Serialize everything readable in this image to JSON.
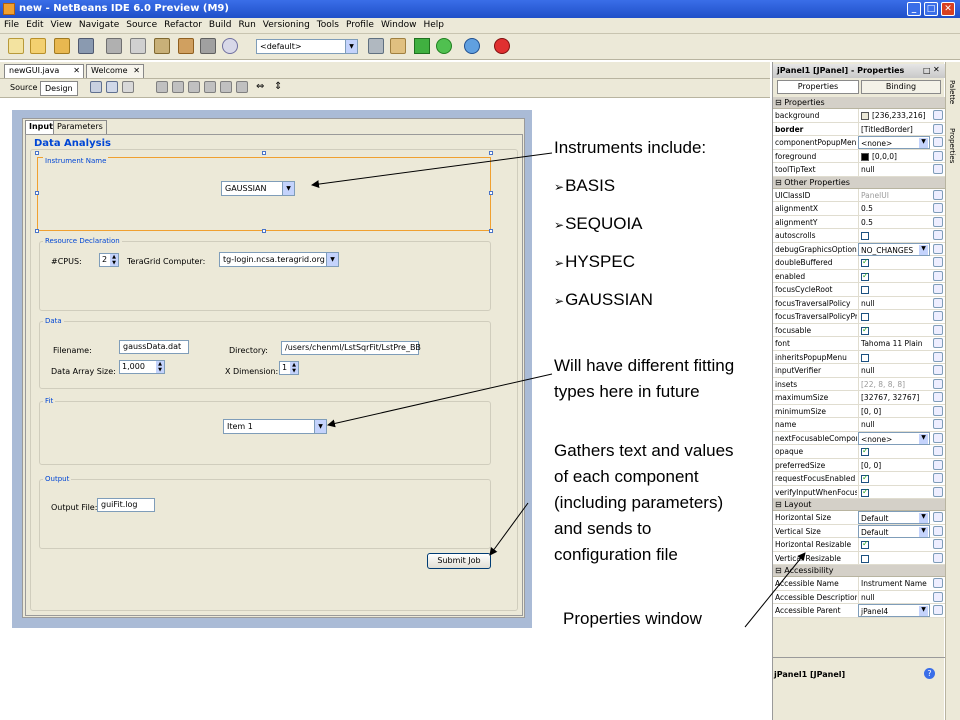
{
  "window": {
    "title": "new - NetBeans IDE 6.0 Preview (M9)"
  },
  "menu": [
    "File",
    "Edit",
    "View",
    "Navigate",
    "Source",
    "Refactor",
    "Build",
    "Run",
    "Versioning",
    "Tools",
    "Profile",
    "Window",
    "Help"
  ],
  "toolbar": {
    "config_value": "<default>"
  },
  "editor_tabs": [
    {
      "label": "newGUI.java"
    },
    {
      "label": "Welcome"
    }
  ],
  "view_buttons": {
    "source": "Source",
    "design": "Design"
  },
  "form": {
    "tabs": [
      "Input",
      "Parameters"
    ],
    "title": "Data Analysis",
    "instrument": {
      "legend": "Instrument Name",
      "value": "GAUSSIAN"
    },
    "resource": {
      "legend": "Resource Declaration",
      "cpus_label": "#CPUS:",
      "cpus_value": "2",
      "computer_label": "TeraGrid Computer:",
      "computer_value": "tg-login.ncsa.teragrid.org"
    },
    "data": {
      "legend": "Data",
      "filename_label": "Filename:",
      "filename_value": "gaussData.dat",
      "directory_label": "Directory:",
      "directory_value": "/users/chenml/LstSqrFit/LstPre_BB",
      "size_label": "Data Array Size:",
      "size_value": "1,000",
      "xdim_label": "X Dimension:",
      "xdim_value": "1"
    },
    "fit": {
      "legend": "Fit",
      "value": "Item 1"
    },
    "output": {
      "legend": "Output",
      "file_label": "Output File:",
      "file_value": "guiFit.log"
    },
    "submit": "Submit Job"
  },
  "properties": {
    "header": "jPanel1 [JPanel] - Properties",
    "tabs": [
      "Properties",
      "Binding"
    ],
    "categories": [
      {
        "name": "Properties",
        "rows": [
          {
            "name": "background",
            "value": "[236,233,216]",
            "swatch": "#ece9d8"
          },
          {
            "name": "border",
            "value": "[TitledBorder]",
            "bold": true
          },
          {
            "name": "componentPopupMenu",
            "value": "<none>",
            "combo": true
          },
          {
            "name": "foreground",
            "value": "[0,0,0]",
            "swatch": "#000000"
          },
          {
            "name": "toolTipText",
            "value": "null"
          }
        ]
      },
      {
        "name": "Other Properties",
        "rows": [
          {
            "name": "UIClassID",
            "value": "PanelUI",
            "grey": true
          },
          {
            "name": "alignmentX",
            "value": "0.5"
          },
          {
            "name": "alignmentY",
            "value": "0.5"
          },
          {
            "name": "autoscrolls",
            "check": false
          },
          {
            "name": "debugGraphicsOptions",
            "value": "NO_CHANGES",
            "combo": true
          },
          {
            "name": "doubleBuffered",
            "check": true
          },
          {
            "name": "enabled",
            "check": true
          },
          {
            "name": "focusCycleRoot",
            "check": false
          },
          {
            "name": "focusTraversalPolicy",
            "value": "null"
          },
          {
            "name": "focusTraversalPolicyPr",
            "check": false
          },
          {
            "name": "focusable",
            "check": true
          },
          {
            "name": "font",
            "value": "Tahoma 11 Plain"
          },
          {
            "name": "inheritsPopupMenu",
            "check": false
          },
          {
            "name": "inputVerifier",
            "value": "null"
          },
          {
            "name": "insets",
            "value": "[22, 8, 8, 8]",
            "grey": true
          },
          {
            "name": "maximumSize",
            "value": "[32767, 32767]"
          },
          {
            "name": "minimumSize",
            "value": "[0, 0]"
          },
          {
            "name": "name",
            "value": "null"
          },
          {
            "name": "nextFocusableCompon",
            "value": "<none>",
            "combo": true
          },
          {
            "name": "opaque",
            "check": true
          },
          {
            "name": "preferredSize",
            "value": "[0, 0]"
          },
          {
            "name": "requestFocusEnabled",
            "check": true
          },
          {
            "name": "verifyInputWhenFocus",
            "check": true
          }
        ]
      },
      {
        "name": "Layout",
        "rows": [
          {
            "name": "Horizontal Size",
            "value": "Default",
            "combo": true
          },
          {
            "name": "Vertical Size",
            "value": "Default",
            "combo": true
          },
          {
            "name": "Horizontal Resizable",
            "check": true
          },
          {
            "name": "Vertical Resizable",
            "check": false
          }
        ]
      },
      {
        "name": "Accessibility",
        "rows": [
          {
            "name": "Accessible Name",
            "value": "Instrument Name"
          },
          {
            "name": "Accessible Description",
            "value": "null"
          },
          {
            "name": "Accessible Parent",
            "value": "jPanel4",
            "combo": true
          }
        ]
      }
    ],
    "footer": "jPanel1 [JPanel]"
  },
  "side_tabs": [
    "Palette",
    "Properties"
  ],
  "annotations": {
    "instruments_heading": "Instruments include:",
    "instruments": [
      "BASIS",
      "SEQUOIA",
      "HYSPEC",
      "GAUSSIAN"
    ],
    "fitting": [
      "Will have different fitting",
      "types here in future"
    ],
    "gathers": [
      "Gathers text and values",
      "of each component",
      "(including parameters)",
      "and sends to",
      "configuration file"
    ],
    "properties_window": "Properties window"
  }
}
